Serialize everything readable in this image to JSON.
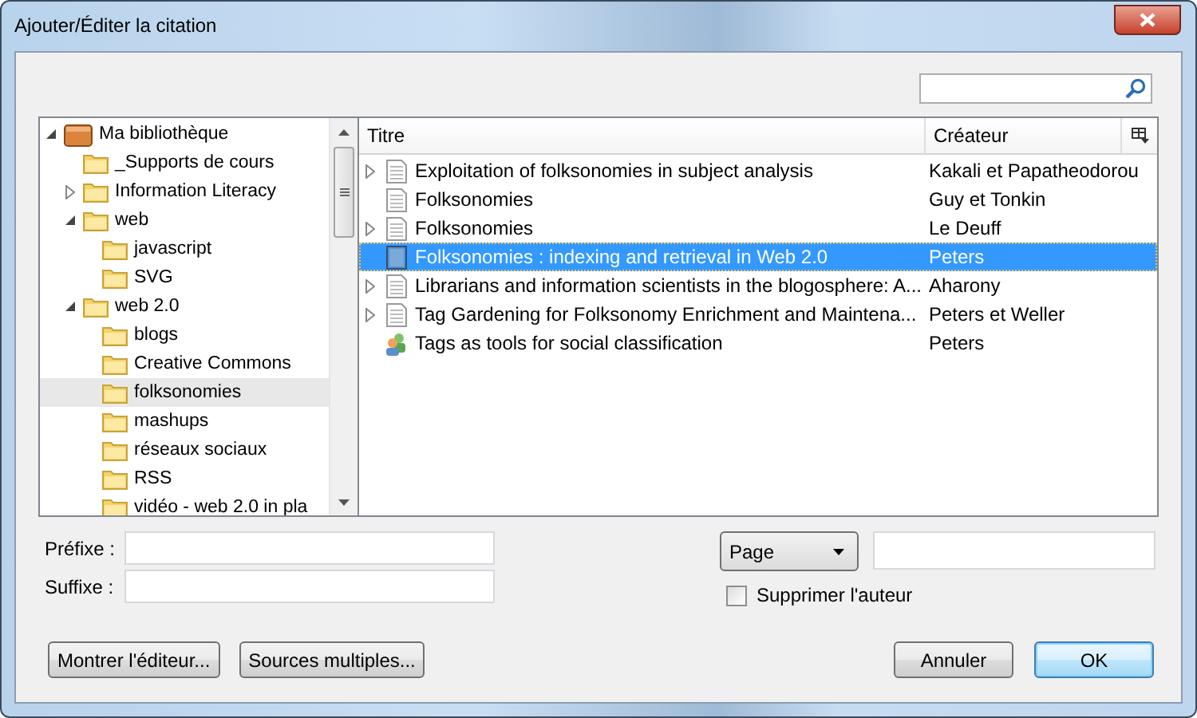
{
  "window": {
    "title": "Ajouter/Éditer la citation"
  },
  "tree": [
    {
      "label": "Ma bibliothèque",
      "kind": "library",
      "selected": false,
      "expanded": true,
      "children": [
        {
          "label": "_Supports de cours",
          "kind": "folder",
          "selected": false
        },
        {
          "label": "Information Literacy",
          "kind": "folder",
          "selected": false,
          "expanded": false
        },
        {
          "label": "web",
          "kind": "folder",
          "selected": false,
          "expanded": true,
          "children": [
            {
              "label": "javascript",
              "kind": "folder",
              "selected": false
            },
            {
              "label": "SVG",
              "kind": "folder",
              "selected": false
            }
          ]
        },
        {
          "label": "web 2.0",
          "kind": "folder",
          "selected": false,
          "expanded": true,
          "children": [
            {
              "label": "blogs",
              "kind": "folder",
              "selected": false
            },
            {
              "label": "Creative Commons",
              "kind": "folder",
              "selected": false
            },
            {
              "label": "folksonomies",
              "kind": "folder",
              "selected": true
            },
            {
              "label": "mashups",
              "kind": "folder",
              "selected": false
            },
            {
              "label": "réseaux sociaux",
              "kind": "folder",
              "selected": false
            },
            {
              "label": "RSS",
              "kind": "folder",
              "selected": false
            },
            {
              "label": "vidéo - web 2.0 in pla",
              "kind": "folder",
              "selected": false
            }
          ]
        }
      ]
    }
  ],
  "items": {
    "columns": [
      "Titre",
      "Créateur"
    ],
    "rows": [
      {
        "title": "Exploitation of folksonomies in subject analysis",
        "creator": "Kakali et Papatheodorou",
        "kind": "document",
        "expanded": false,
        "selected": false
      },
      {
        "title": "Folksonomies",
        "creator": "Guy et Tonkin",
        "kind": "document",
        "selected": false
      },
      {
        "title": "Folksonomies",
        "creator": "Le Deuff",
        "kind": "document",
        "expanded": false,
        "selected": false
      },
      {
        "title": "Folksonomies : indexing and retrieval in Web 2.0",
        "creator": "Peters",
        "kind": "book",
        "selected": true
      },
      {
        "title": "Librarians and information scientists in the blogosphere: A...",
        "creator": "Aharony",
        "kind": "document",
        "expanded": false,
        "selected": false
      },
      {
        "title": "Tag Gardening for Folksonomy Enrichment and Maintena...",
        "creator": "Peters et Weller",
        "kind": "document",
        "expanded": false,
        "selected": false
      },
      {
        "title": "Tags as tools for social classification",
        "creator": "Peters",
        "kind": "presentation",
        "selected": false
      }
    ]
  },
  "form": {
    "prefix_label": "Préfixe :",
    "suffix_label": "Suffixe :",
    "locator": "Page",
    "suppress_author": {
      "label": "Supprimer l'auteur",
      "checked": false
    }
  },
  "buttons_left": [
    "Montrer l'éditeur...",
    "Sources multiples..."
  ],
  "buttons_right": [
    {
      "label": "Annuler",
      "default": false
    },
    {
      "label": "OK",
      "default": true
    }
  ]
}
